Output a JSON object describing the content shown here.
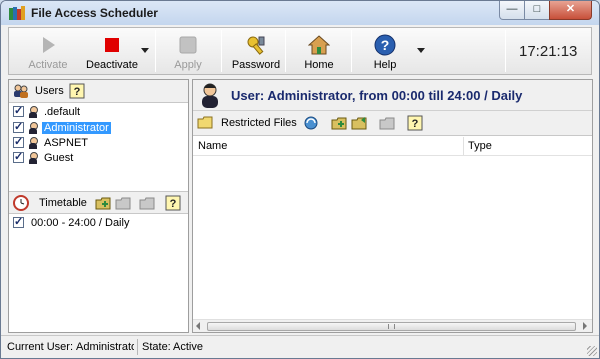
{
  "window": {
    "title": "File Access Scheduler"
  },
  "toolbar": {
    "activate": "Activate",
    "deactivate": "Deactivate",
    "apply": "Apply",
    "password": "Password",
    "home": "Home",
    "help": "Help",
    "clock": "17:21:13"
  },
  "users": {
    "header": "Users",
    "items": [
      {
        "name": ".default",
        "checked": true
      },
      {
        "name": "Administrator",
        "checked": true,
        "selected": true
      },
      {
        "name": "ASPNET",
        "checked": true
      },
      {
        "name": "Guest",
        "checked": true
      }
    ]
  },
  "timetable": {
    "header": "Timetable",
    "items": [
      {
        "label": "00:00 - 24:00 / Daily",
        "checked": true
      }
    ]
  },
  "main": {
    "user_header": "User: Administrator, from  00:00  till  24:00 / Daily",
    "restricted_files": "Restricted Files",
    "columns": {
      "name": "Name",
      "type": "Type"
    }
  },
  "status": {
    "current_user_label": "Current User:",
    "current_user_value": "Administrator",
    "state_label": "State:",
    "state_value": "Active"
  },
  "colors": {
    "accent": "#1a2a6e",
    "selection": "#3399ff",
    "deactivate": "#e00000"
  }
}
